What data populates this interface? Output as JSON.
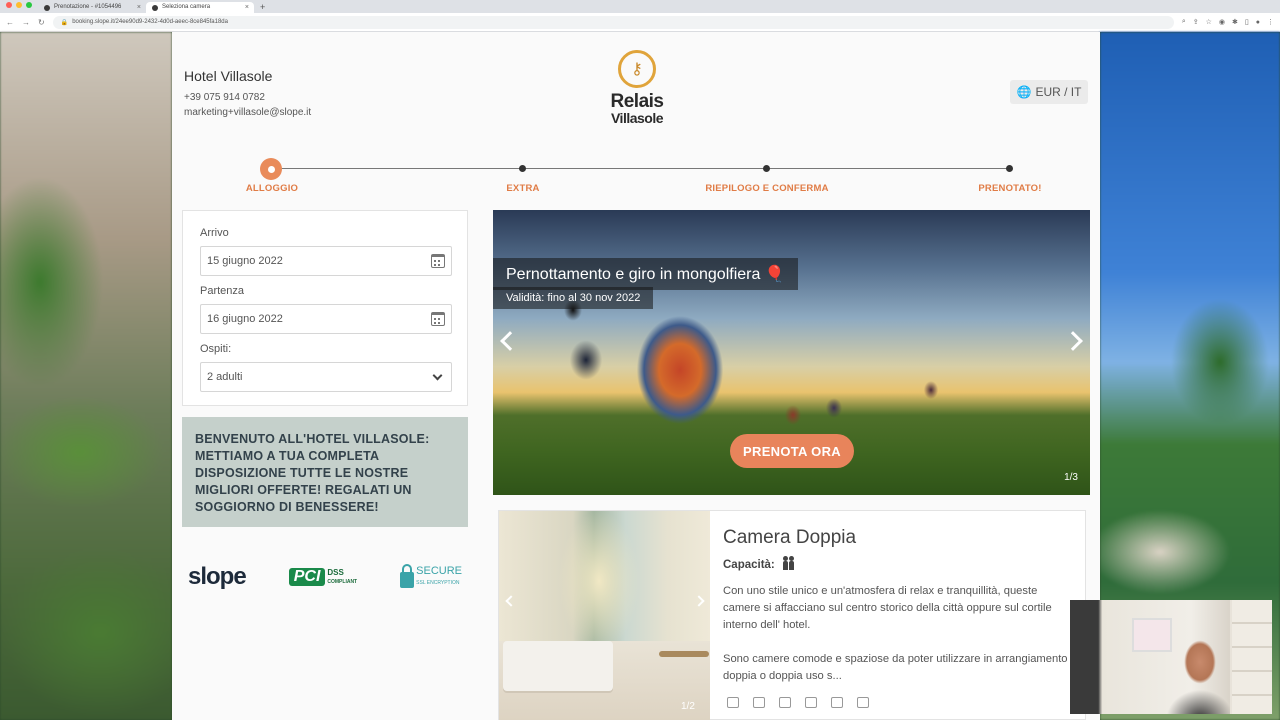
{
  "browser": {
    "tabs": [
      {
        "label": "Prenotazione - #1054496",
        "active": false
      },
      {
        "label": "Seleziona camera",
        "active": true
      }
    ],
    "new_tab": "+",
    "url": "booking.slope.it/24ee90d9-2432-4d0d-aeec-8ce845fa18da"
  },
  "hotel": {
    "name": "Hotel Villasole",
    "phone": "+39 075 914 0782",
    "email": "marketing+villasole@slope.it"
  },
  "logo": {
    "line1": "Relais",
    "line2": "Villasole"
  },
  "currency": {
    "label": "EUR / IT"
  },
  "steps": [
    {
      "label": "ALLOGGIO",
      "active": true
    },
    {
      "label": "EXTRA",
      "active": false
    },
    {
      "label": "RIEPILOGO E CONFERMA",
      "active": false
    },
    {
      "label": "PRENOTATO!",
      "active": false
    }
  ],
  "form": {
    "arrival_label": "Arrivo",
    "arrival_value": "15 giugno 2022",
    "departure_label": "Partenza",
    "departure_value": "16 giugno 2022",
    "guests_label": "Ospiti:",
    "guests_value": "2 adulti"
  },
  "welcome": "BENVENUTO ALL'HOTEL VILLASOLE: METTIAMO A TUA COMPLETA DISPOSIZIONE TUTTE LE NOSTRE MIGLIORI OFFERTE! REGALATI UN SOGGIORNO DI BENESSERE!",
  "partner_logos": {
    "slope": "slope",
    "pci_badge": "PCI",
    "pci_text": "DSS",
    "pci_sub": "COMPLIANT",
    "secure": "SECURE",
    "secure_sub": "SSL ENCRYPTION"
  },
  "promo": {
    "title": "Pernottamento e giro in mongolfiera 🎈",
    "validity": "Validità: fino al 30 nov 2022",
    "cta": "PRENOTA ORA",
    "counter": "1/3"
  },
  "room": {
    "title": "Camera Doppia",
    "capacity_label": "Capacità:",
    "description_1": "Con uno stile unico e un'atmosfera di relax e tranquillità, queste camere si affacciano sul centro storico della città oppure sul cortile interno dell' hotel.",
    "description_2": "Sono camere comode e spaziose da poter utilizzare in arrangiamento doppia o doppia uso s...",
    "photo_counter": "1/2",
    "amenities": [
      "printer-icon",
      "hairdryer-icon",
      "phone-icon",
      "safe-icon",
      "iron-icon",
      "tv-icon"
    ]
  },
  "colors": {
    "accent": "#e8845b",
    "welcome_bg": "#c5d0cb"
  }
}
